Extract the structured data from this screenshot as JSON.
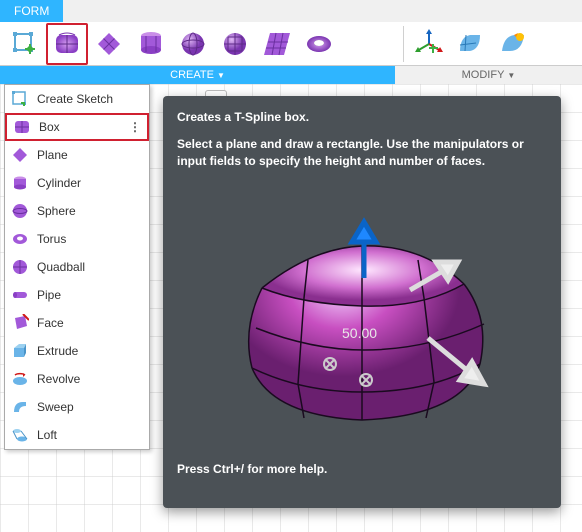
{
  "tab": {
    "label": "FORM"
  },
  "panels": {
    "create_label": "CREATE",
    "modify_label": "MODIFY"
  },
  "menu": {
    "items": [
      {
        "label": "Create Sketch",
        "icon": "sketch"
      },
      {
        "label": "Box",
        "icon": "box"
      },
      {
        "label": "Plane",
        "icon": "plane"
      },
      {
        "label": "Cylinder",
        "icon": "cylinder"
      },
      {
        "label": "Sphere",
        "icon": "sphere"
      },
      {
        "label": "Torus",
        "icon": "torus"
      },
      {
        "label": "Quadball",
        "icon": "quadball"
      },
      {
        "label": "Pipe",
        "icon": "pipe"
      },
      {
        "label": "Face",
        "icon": "face"
      },
      {
        "label": "Extrude",
        "icon": "extrude"
      },
      {
        "label": "Revolve",
        "icon": "revolve"
      },
      {
        "label": "Sweep",
        "icon": "sweep"
      },
      {
        "label": "Loft",
        "icon": "loft"
      }
    ]
  },
  "tooltip": {
    "title": "Creates a T-Spline box.",
    "desc": "Select a plane and draw a rectangle. Use the manipulators or input fields to specify the height and number of faces.",
    "dim": "50.00",
    "hint": "Press Ctrl+/ for more help."
  },
  "colors": {
    "accent": "#2fb5ff",
    "purple": "#a259d9",
    "highlight": "#d02030",
    "render": "#b03fa8"
  },
  "symbols": {
    "dropdown": "▼",
    "dots": "⋮",
    "minus": "−"
  }
}
